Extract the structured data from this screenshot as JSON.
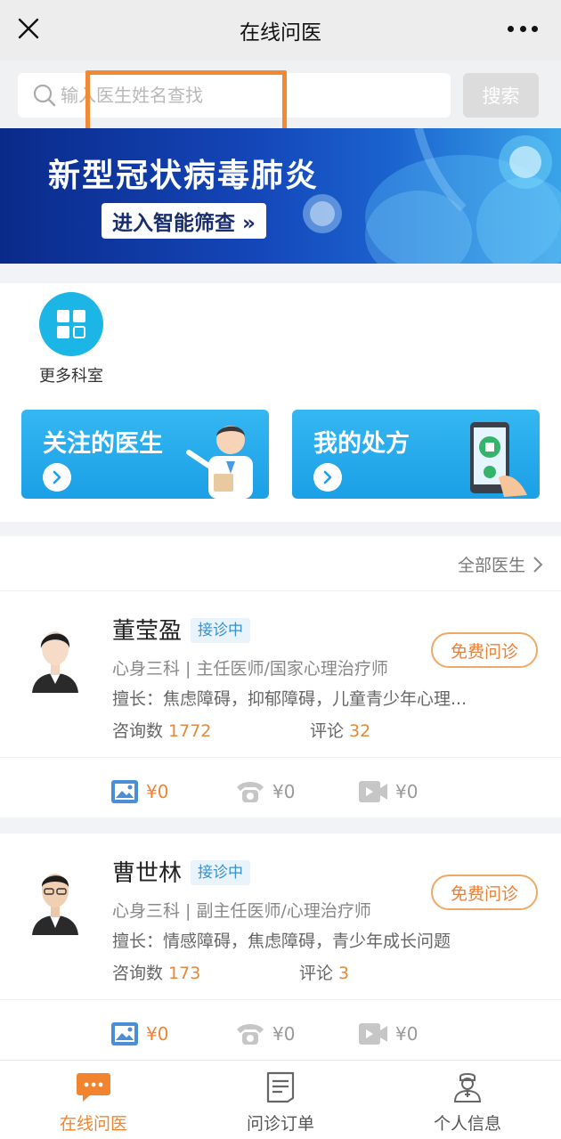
{
  "nav": {
    "title": "在线问医"
  },
  "search": {
    "placeholder": "输入医生姓名查找",
    "button": "搜索"
  },
  "banner": {
    "headline": "新型冠状病毒肺炎",
    "cta": "进入智能筛查 »"
  },
  "departments": {
    "more_label": "更多科室"
  },
  "cards": [
    {
      "title": "关注的医生"
    },
    {
      "title": "我的处方"
    }
  ],
  "doctor_list": {
    "all_label": "全部医生",
    "doctors": [
      {
        "name": "董莹盈",
        "status": "接诊中",
        "dept": "心身三科 | 主任医师/国家心理治疗师",
        "skill": "擅长：焦虑障碍，抑郁障碍，儿童青少年心理...",
        "consult_label": "咨询数",
        "consult_count": "1772",
        "comment_label": "评论",
        "comment_count": "32",
        "free_btn": "免费问诊",
        "services": {
          "image": "¥0",
          "phone": "¥0",
          "video": "¥0"
        }
      },
      {
        "name": "曹世林",
        "status": "接诊中",
        "dept": "心身三科 | 副主任医师/心理治疗师",
        "skill": "擅长：情感障碍，焦虑障碍，青少年成长问题",
        "consult_label": "咨询数",
        "consult_count": "173",
        "comment_label": "评论",
        "comment_count": "3",
        "free_btn": "免费问诊",
        "services": {
          "image": "¥0",
          "phone": "¥0",
          "video": "¥0"
        }
      }
    ]
  },
  "tabbar": {
    "items": [
      {
        "label": "在线问医",
        "active": true
      },
      {
        "label": "问诊订单",
        "active": false
      },
      {
        "label": "个人信息",
        "active": false
      }
    ]
  },
  "colors": {
    "accent": "#f2842f",
    "blue": "#1ba3e8",
    "highlight": "#f28a35"
  },
  "icons": {
    "close": "close-icon",
    "more": "more-icon",
    "search": "search-icon",
    "grid": "grid-icon",
    "chevron": "chevron-right-icon",
    "image": "image-icon",
    "phone": "phone-icon",
    "video": "video-icon",
    "chat": "chat-icon",
    "order": "order-icon",
    "profile": "doctor-profile-icon"
  }
}
